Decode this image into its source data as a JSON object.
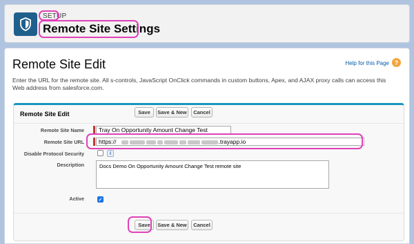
{
  "header": {
    "breadcrumb": "SETUP",
    "title": "Remote Site Settings",
    "icon": "shield-icon"
  },
  "main": {
    "title": "Remote Site Edit",
    "help_link": "Help for this Page",
    "description": "Enter the URL for the remote site. All s-controls, JavaScript OnClick commands in custom buttons, Apex, and AJAX proxy calls can access this Web address from salesforce.com."
  },
  "panel": {
    "title": "Remote Site Edit",
    "buttons": {
      "save": "Save",
      "save_new": "Save & New",
      "cancel": "Cancel"
    }
  },
  "form": {
    "remote_site_name": {
      "label": "Remote Site Name",
      "value": "Tray On Opportunity Amount Change Test"
    },
    "remote_site_url": {
      "label": "Remote Site URL",
      "prefix": "https://",
      "suffix": ".trayapp.io"
    },
    "disable_protocol_security": {
      "label": "Disable Protocol Security",
      "checked": false,
      "info": "i"
    },
    "description": {
      "label": "Description",
      "value": "Docs Demo On Opportunity Amount Change Test remote site"
    },
    "active": {
      "label": "Active",
      "checked": true
    }
  },
  "colors": {
    "highlight": "#e040b8",
    "panel_accent": "#1797c0",
    "required": "#c23934",
    "background": "#b0c4df"
  }
}
